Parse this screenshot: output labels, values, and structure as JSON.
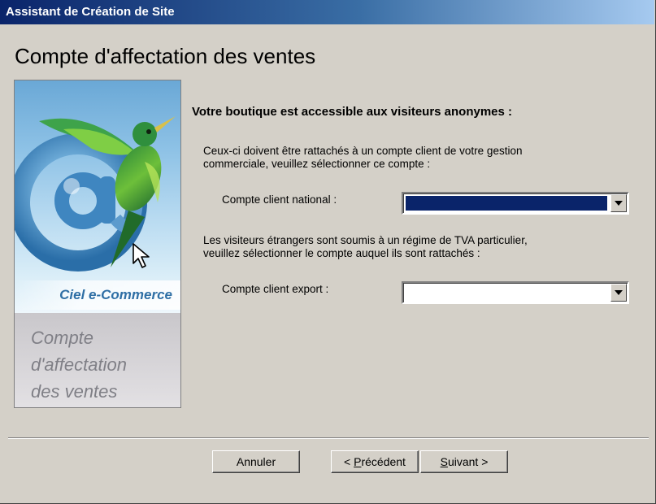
{
  "window": {
    "title": "Assistant de Création de Site"
  },
  "page": {
    "heading": "Compte d'affectation des ventes"
  },
  "side_panel": {
    "brand": "Ciel e-Commerce",
    "caption_lines": [
      "Compte",
      "d'affectation",
      "des ventes"
    ]
  },
  "content": {
    "section_title": "Votre boutique est accessible aux visiteurs anonymes :",
    "national_text": [
      "Ceux-ci doivent être rattachés à un compte client de votre gestion",
      "commerciale, veuillez sélectionner ce compte :"
    ],
    "national_label": "Compte client national :",
    "national_value": "",
    "export_text": [
      "Les visiteurs étrangers sont soumis à un régime de TVA particulier,",
      "veuillez sélectionner le compte auquel ils sont rattachés :"
    ],
    "export_label": "Compte client export :",
    "export_value": ""
  },
  "buttons": {
    "cancel": "Annuler",
    "previous_prefix": "< ",
    "previous_hotkey": "P",
    "previous_rest": "récédent",
    "next_hotkey": "S",
    "next_rest": "uivant >"
  },
  "colors": {
    "titlebar": "#0a246a",
    "selection": "#0a246a",
    "brand": "#2f6fa5",
    "dialog_bg": "#d4d0c8"
  }
}
